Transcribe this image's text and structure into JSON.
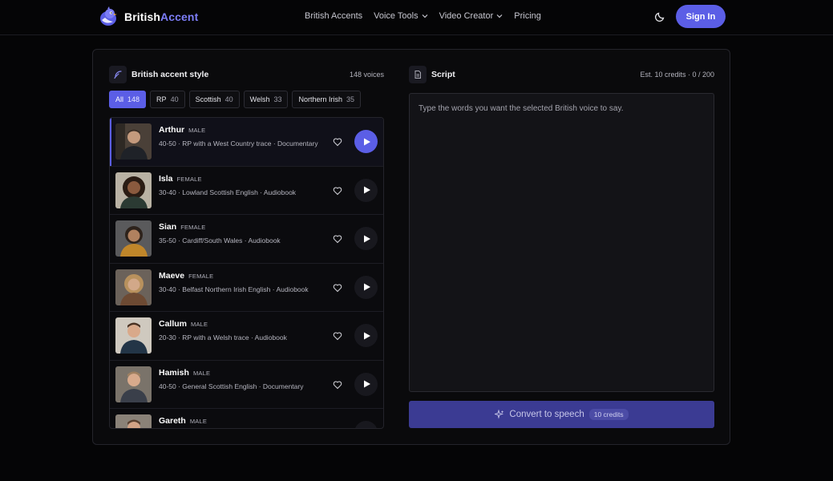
{
  "header": {
    "logo_text_main": "British",
    "logo_text_accent": "Accent",
    "nav": [
      {
        "label": "British Accents",
        "dropdown": false
      },
      {
        "label": "Voice Tools",
        "dropdown": true
      },
      {
        "label": "Video Creator",
        "dropdown": true
      },
      {
        "label": "Pricing",
        "dropdown": false
      }
    ],
    "signin_label": "Sign In"
  },
  "voices_panel": {
    "title": "British accent style",
    "count_label": "148 voices",
    "filters": [
      {
        "label": "All",
        "count": "148",
        "active": true
      },
      {
        "label": "RP",
        "count": "40",
        "active": false
      },
      {
        "label": "Scottish",
        "count": "40",
        "active": false
      },
      {
        "label": "Welsh",
        "count": "33",
        "active": false
      },
      {
        "label": "Northern Irish",
        "count": "35",
        "active": false
      }
    ],
    "voices": [
      {
        "name": "Arthur",
        "gender": "MALE",
        "desc": "40-50 · RP with a West Country trace · Documentary",
        "selected": true
      },
      {
        "name": "Isla",
        "gender": "FEMALE",
        "desc": "30-40 · Lowland Scottish English · Audiobook",
        "selected": false
      },
      {
        "name": "Sian",
        "gender": "FEMALE",
        "desc": "35-50 · Cardiff/South Wales · Audiobook",
        "selected": false
      },
      {
        "name": "Maeve",
        "gender": "FEMALE",
        "desc": "30-40 · Belfast Northern Irish English · Audiobook",
        "selected": false
      },
      {
        "name": "Callum",
        "gender": "MALE",
        "desc": "20-30 · RP with a Welsh trace · Audiobook",
        "selected": false
      },
      {
        "name": "Hamish",
        "gender": "MALE",
        "desc": "40-50 · General Scottish English · Documentary",
        "selected": false
      },
      {
        "name": "Gareth",
        "gender": "MALE",
        "desc": "",
        "selected": false
      }
    ]
  },
  "script_panel": {
    "title": "Script",
    "estimate": "Est. 10 credits · 0 / 200",
    "placeholder": "Type the words you want the selected British voice to say.",
    "convert_label": "Convert to speech",
    "convert_credits": "10 credits"
  },
  "colors": {
    "accent": "#5b5ee6",
    "background": "#050506",
    "panel": "#0a0a0c"
  }
}
